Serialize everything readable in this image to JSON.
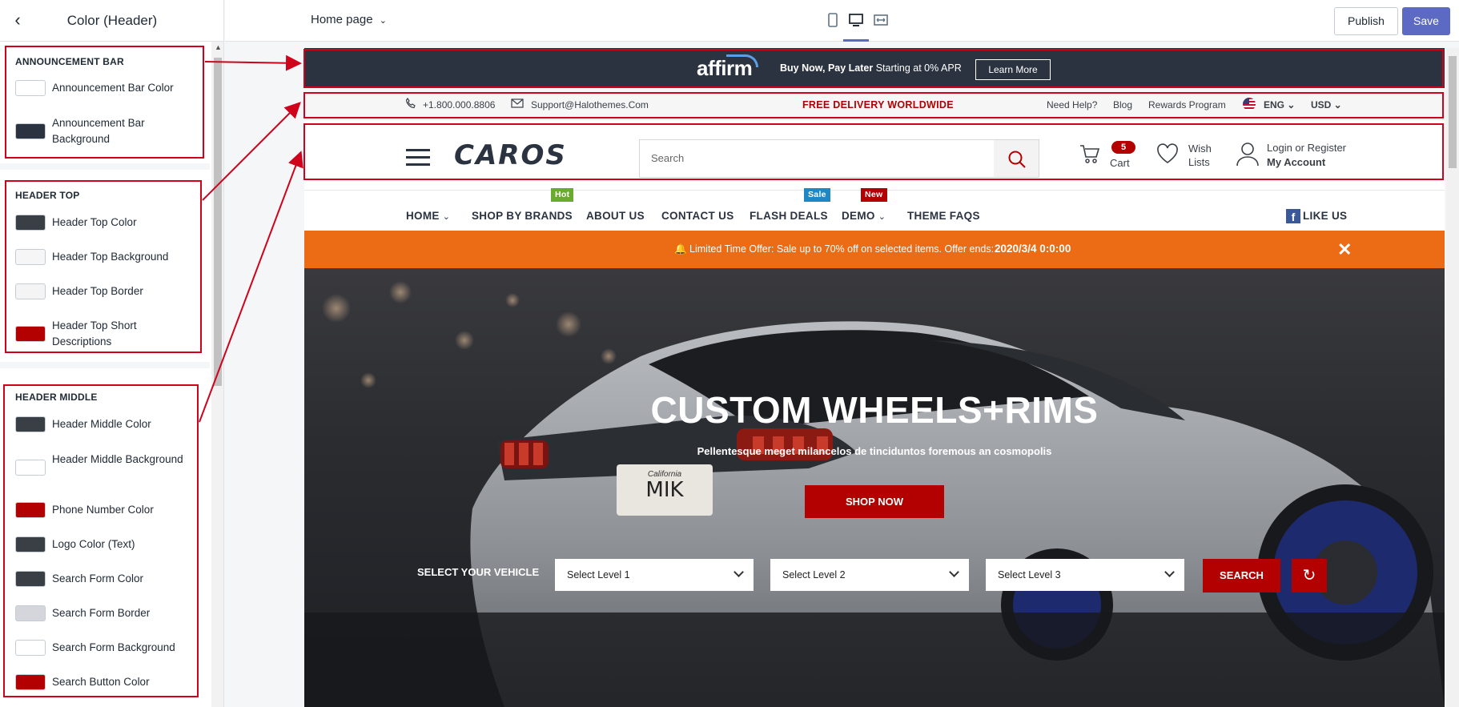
{
  "sidebar": {
    "title": "Color (Header)",
    "groups": [
      {
        "title": "ANNOUNCEMENT BAR",
        "options": [
          {
            "label": "Announcement Bar Color",
            "color": "#ffffff"
          },
          {
            "label": "Announcement Bar Background",
            "color": "#2b3340"
          }
        ]
      },
      {
        "title": "HEADER TOP",
        "options": [
          {
            "label": "Header Top Color",
            "color": "#3a3f46"
          },
          {
            "label": "Header Top Background",
            "color": "#f6f6f6"
          },
          {
            "label": "Header Top Border",
            "color": "#f4f4f4"
          },
          {
            "label": "Header Top Short Descriptions",
            "color": "#b30000"
          }
        ]
      },
      {
        "title": "HEADER MIDDLE",
        "options": [
          {
            "label": "Header Middle Color",
            "color": "#3a3f46"
          },
          {
            "label": "Header Middle Background",
            "color": "#ffffff"
          },
          {
            "label": "Phone Number Color",
            "color": "#b30000"
          },
          {
            "label": "Logo Color (Text)",
            "color": "#3a3f46"
          },
          {
            "label": "Search Form Color",
            "color": "#3a3f46"
          },
          {
            "label": "Search Form Border",
            "color": "#d4d6db"
          },
          {
            "label": "Search Form Background",
            "color": "#ffffff"
          },
          {
            "label": "Search Button Color",
            "color": "#b30000"
          }
        ]
      }
    ]
  },
  "topbar": {
    "page_select": "Home page",
    "publish": "Publish",
    "save": "Save"
  },
  "preview": {
    "announcement": {
      "logo": "affirm",
      "text_bold": "Buy Now, Pay Later",
      "text_rest": " Starting at 0% APR",
      "button": "Learn More"
    },
    "header_top": {
      "phone": "+1.800.000.8806",
      "email": "Support@Halothemes.Com",
      "free_delivery": "FREE DELIVERY WORLDWIDE",
      "links": [
        "Need Help?",
        "Blog",
        "Rewards Program"
      ],
      "language": "ENG",
      "currency": "USD"
    },
    "header_middle": {
      "logo": "CAROS",
      "search_placeholder": "Search",
      "cart_count": "5",
      "cart_label": "Cart",
      "wish_line1": "Wish",
      "wish_line2": "Lists",
      "login": "Login or Register",
      "account": "My Account"
    },
    "nav": {
      "items": [
        "HOME",
        "SHOP BY BRANDS",
        "ABOUT US",
        "CONTACT US",
        "FLASH DEALS",
        "DEMO",
        "THEME FAQS"
      ],
      "badges": {
        "hot": "Hot",
        "sale": "Sale",
        "new": "New"
      },
      "like": "LIKE US"
    },
    "offer": {
      "text": "🔔 Limited Time Offer: Sale up to 70% off on selected items. Offer ends:",
      "date": "2020/3/4 0:0:00",
      "close": "✕"
    },
    "hero": {
      "title": "CUSTOM WHEELS+RIMS",
      "subtitle": "Pellentesque meget milancelos de tinciduntos foremous an cosmopolis",
      "button": "SHOP NOW",
      "plate_top": "California",
      "plate_text": "MIK",
      "select_label": "SELECT YOUR VEHICLE",
      "selects": [
        "Select Level 1",
        "Select Level 2",
        "Select Level 3"
      ],
      "search_button": "SEARCH"
    }
  },
  "colors": {
    "accent": "#5c6ac4",
    "annotation": "#d0021b",
    "brand_red": "#b30000",
    "offer_orange": "#ec6c15"
  }
}
